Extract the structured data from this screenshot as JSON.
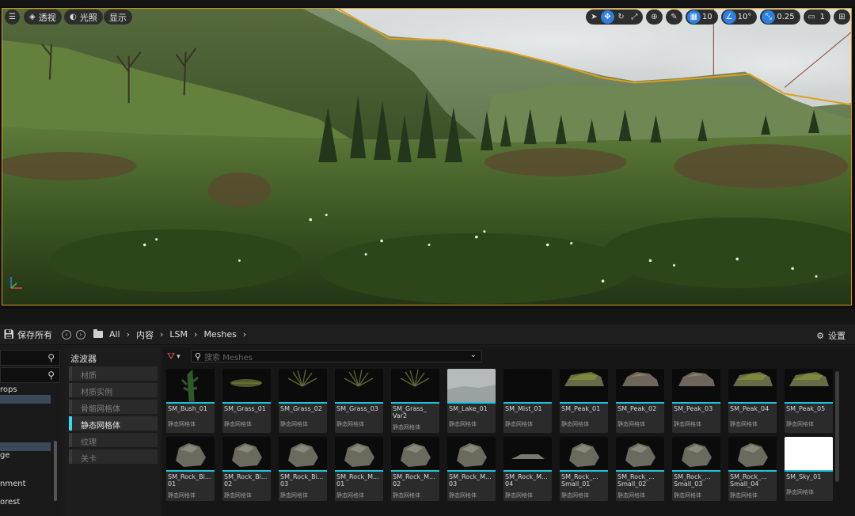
{
  "viewport": {
    "pills": {
      "menu": "☰",
      "view_mode": "透视",
      "lighting": "光照",
      "show": "显示"
    },
    "tools": {
      "grid_snap": "10",
      "rotation_snap": "10°",
      "scale_snap": "0.25",
      "camera_speed": "1"
    }
  },
  "toolbar": {
    "save_all": "保存所有",
    "breadcrumbs": [
      "All",
      "内容",
      "LSM",
      "Meshes"
    ],
    "settings": "设置"
  },
  "tree": {
    "items": [
      "rops",
      "ge",
      "nment",
      "orest"
    ]
  },
  "filters": {
    "title": "滤波器",
    "items": [
      {
        "label": "材质",
        "active": false
      },
      {
        "label": "材质实例",
        "active": false
      },
      {
        "label": "骨骼网格体",
        "active": false
      },
      {
        "label": "静态网格体",
        "active": true
      },
      {
        "label": "纹理",
        "active": false
      },
      {
        "label": "关卡",
        "active": false
      }
    ]
  },
  "assets": {
    "search_placeholder": "搜索 Meshes",
    "row1": [
      {
        "name": "SM_Bush_01",
        "type": "静态网格体",
        "kind": "bush"
      },
      {
        "name": "SM_Grass_01",
        "type": "静态网格体",
        "kind": "grass"
      },
      {
        "name": "SM_Grass_02",
        "type": "静态网格体",
        "kind": "grass2"
      },
      {
        "name": "SM_Grass_03",
        "type": "静态网格体",
        "kind": "grass2"
      },
      {
        "name": "SM_Grass_\nVar2",
        "type": "静态网格体",
        "kind": "grass2"
      },
      {
        "name": "SM_Lake_01",
        "type": "静态网格体",
        "kind": "lake"
      },
      {
        "name": "SM_Mist_01",
        "type": "静态网格体",
        "kind": "dark"
      },
      {
        "name": "SM_Peak_01",
        "type": "静态网格体",
        "kind": "peak_green"
      },
      {
        "name": "SM_Peak_02",
        "type": "静态网格体",
        "kind": "peak_brown"
      },
      {
        "name": "SM_Peak_03",
        "type": "静态网格体",
        "kind": "peak_brown"
      },
      {
        "name": "SM_Peak_04",
        "type": "静态网格体",
        "kind": "peak_green"
      },
      {
        "name": "SM_Peak_05",
        "type": "静态网格体",
        "kind": "peak_green"
      }
    ],
    "row2": [
      {
        "name": "SM_Rock_Bi...\n01",
        "type": "静态网格体",
        "kind": "rock"
      },
      {
        "name": "SM_Rock_Bi...\n02",
        "type": "静态网格体",
        "kind": "rock"
      },
      {
        "name": "SM_Rock_Bi...\n03",
        "type": "静态网格体",
        "kind": "rock"
      },
      {
        "name": "SM_Rock_M...\n01",
        "type": "静态网格体",
        "kind": "rock"
      },
      {
        "name": "SM_Rock_M...\n02",
        "type": "静态网格体",
        "kind": "rock"
      },
      {
        "name": "SM_Rock_M...\n03",
        "type": "静态网格体",
        "kind": "rock"
      },
      {
        "name": "SM_Rock_M...\n04",
        "type": "静态网格体",
        "kind": "rock_flat"
      },
      {
        "name": "SM_Rock_...\nSmall_01",
        "type": "静态网格体",
        "kind": "rock"
      },
      {
        "name": "SM_Rock_...\nSmall_02",
        "type": "静态网格体",
        "kind": "rock"
      },
      {
        "name": "SM_Rock_...\nSmall_03",
        "type": "静态网格体",
        "kind": "rock"
      },
      {
        "name": "SM_Rock_...\nSmall_04",
        "type": "静态网格体",
        "kind": "rock"
      },
      {
        "name": "SM_Sky_01",
        "type": "静态网格体",
        "kind": "sky"
      }
    ]
  },
  "colors": {
    "accent": "#19c6dc",
    "selection_outline": "#d69a1c",
    "active_tool": "#2f7fe0"
  }
}
